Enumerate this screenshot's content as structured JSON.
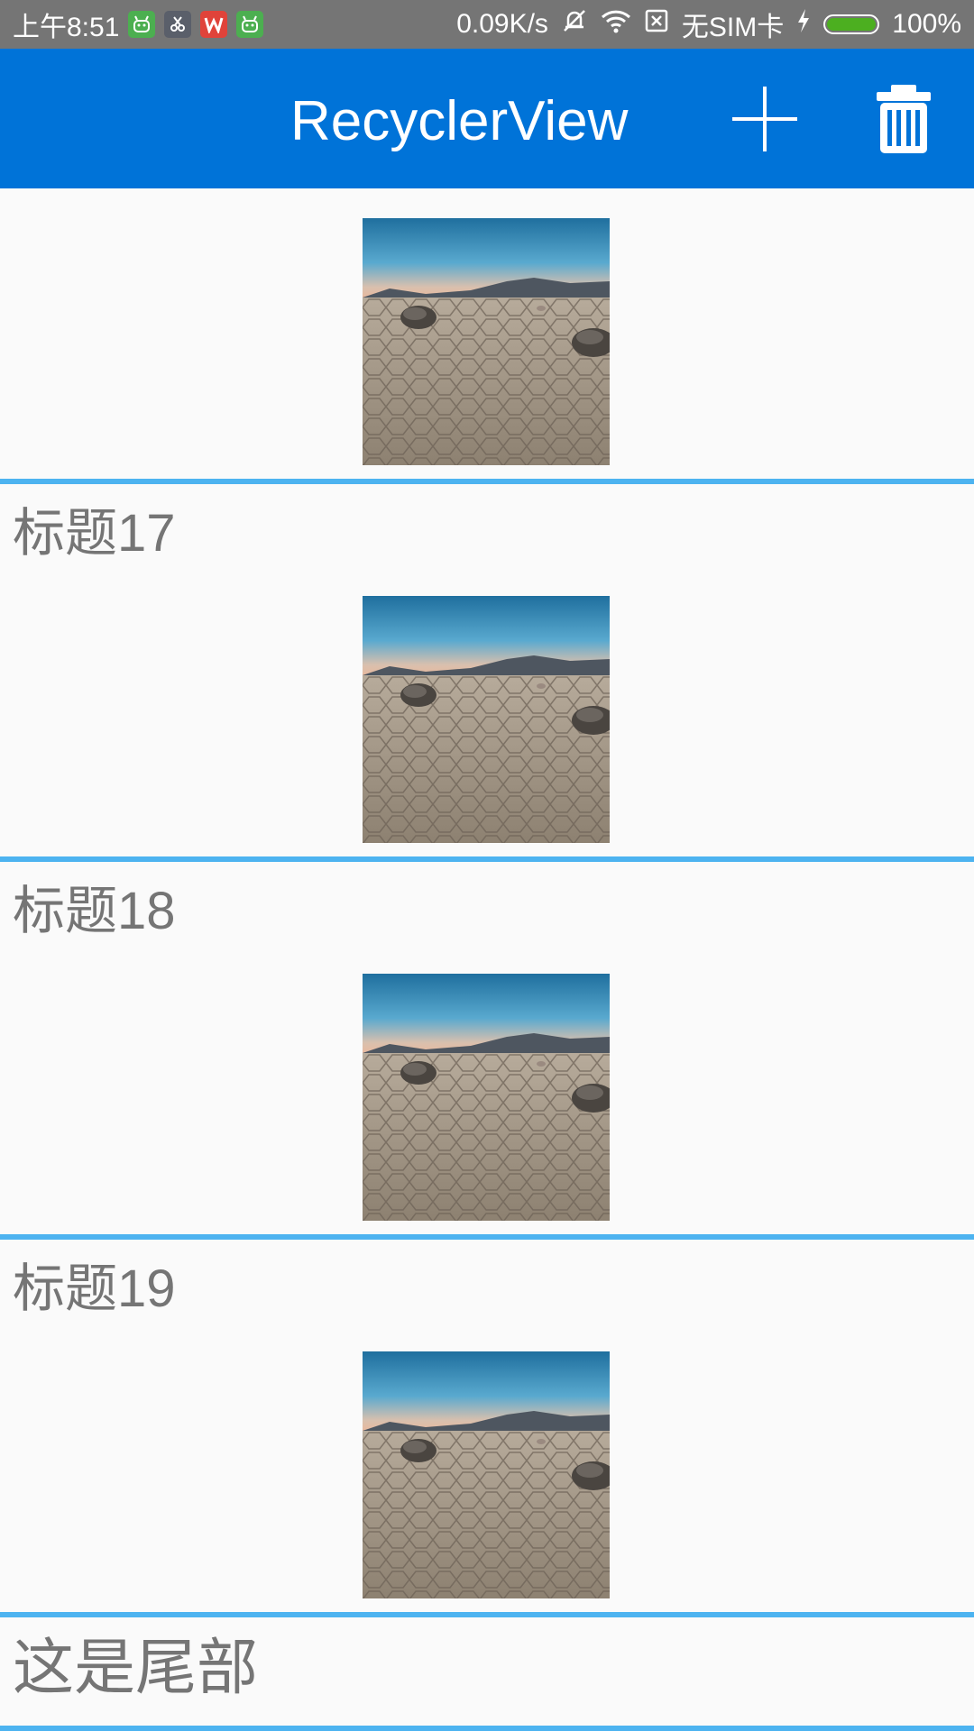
{
  "status_bar": {
    "time": "上午8:51",
    "speed": "0.09K/s",
    "sim": "无SIM卡",
    "battery": "100%",
    "battery_level": 1.0,
    "notification_icons": [
      "android-icon",
      "scissors-icon",
      "wps-icon",
      "android-icon"
    ]
  },
  "toolbar": {
    "title": "RecyclerView",
    "add_icon": "plus-icon",
    "delete_icon": "trash-icon",
    "color": "#0073d8"
  },
  "list": {
    "items": [
      {
        "title": "",
        "image": "desert-rocks-photo"
      },
      {
        "title": "标题17",
        "image": "desert-rocks-photo"
      },
      {
        "title": "标题18",
        "image": "desert-rocks-photo"
      },
      {
        "title": "标题19",
        "image": "desert-rocks-photo"
      }
    ],
    "footer": "这是尾部",
    "divider_color": "#4db3f0"
  }
}
